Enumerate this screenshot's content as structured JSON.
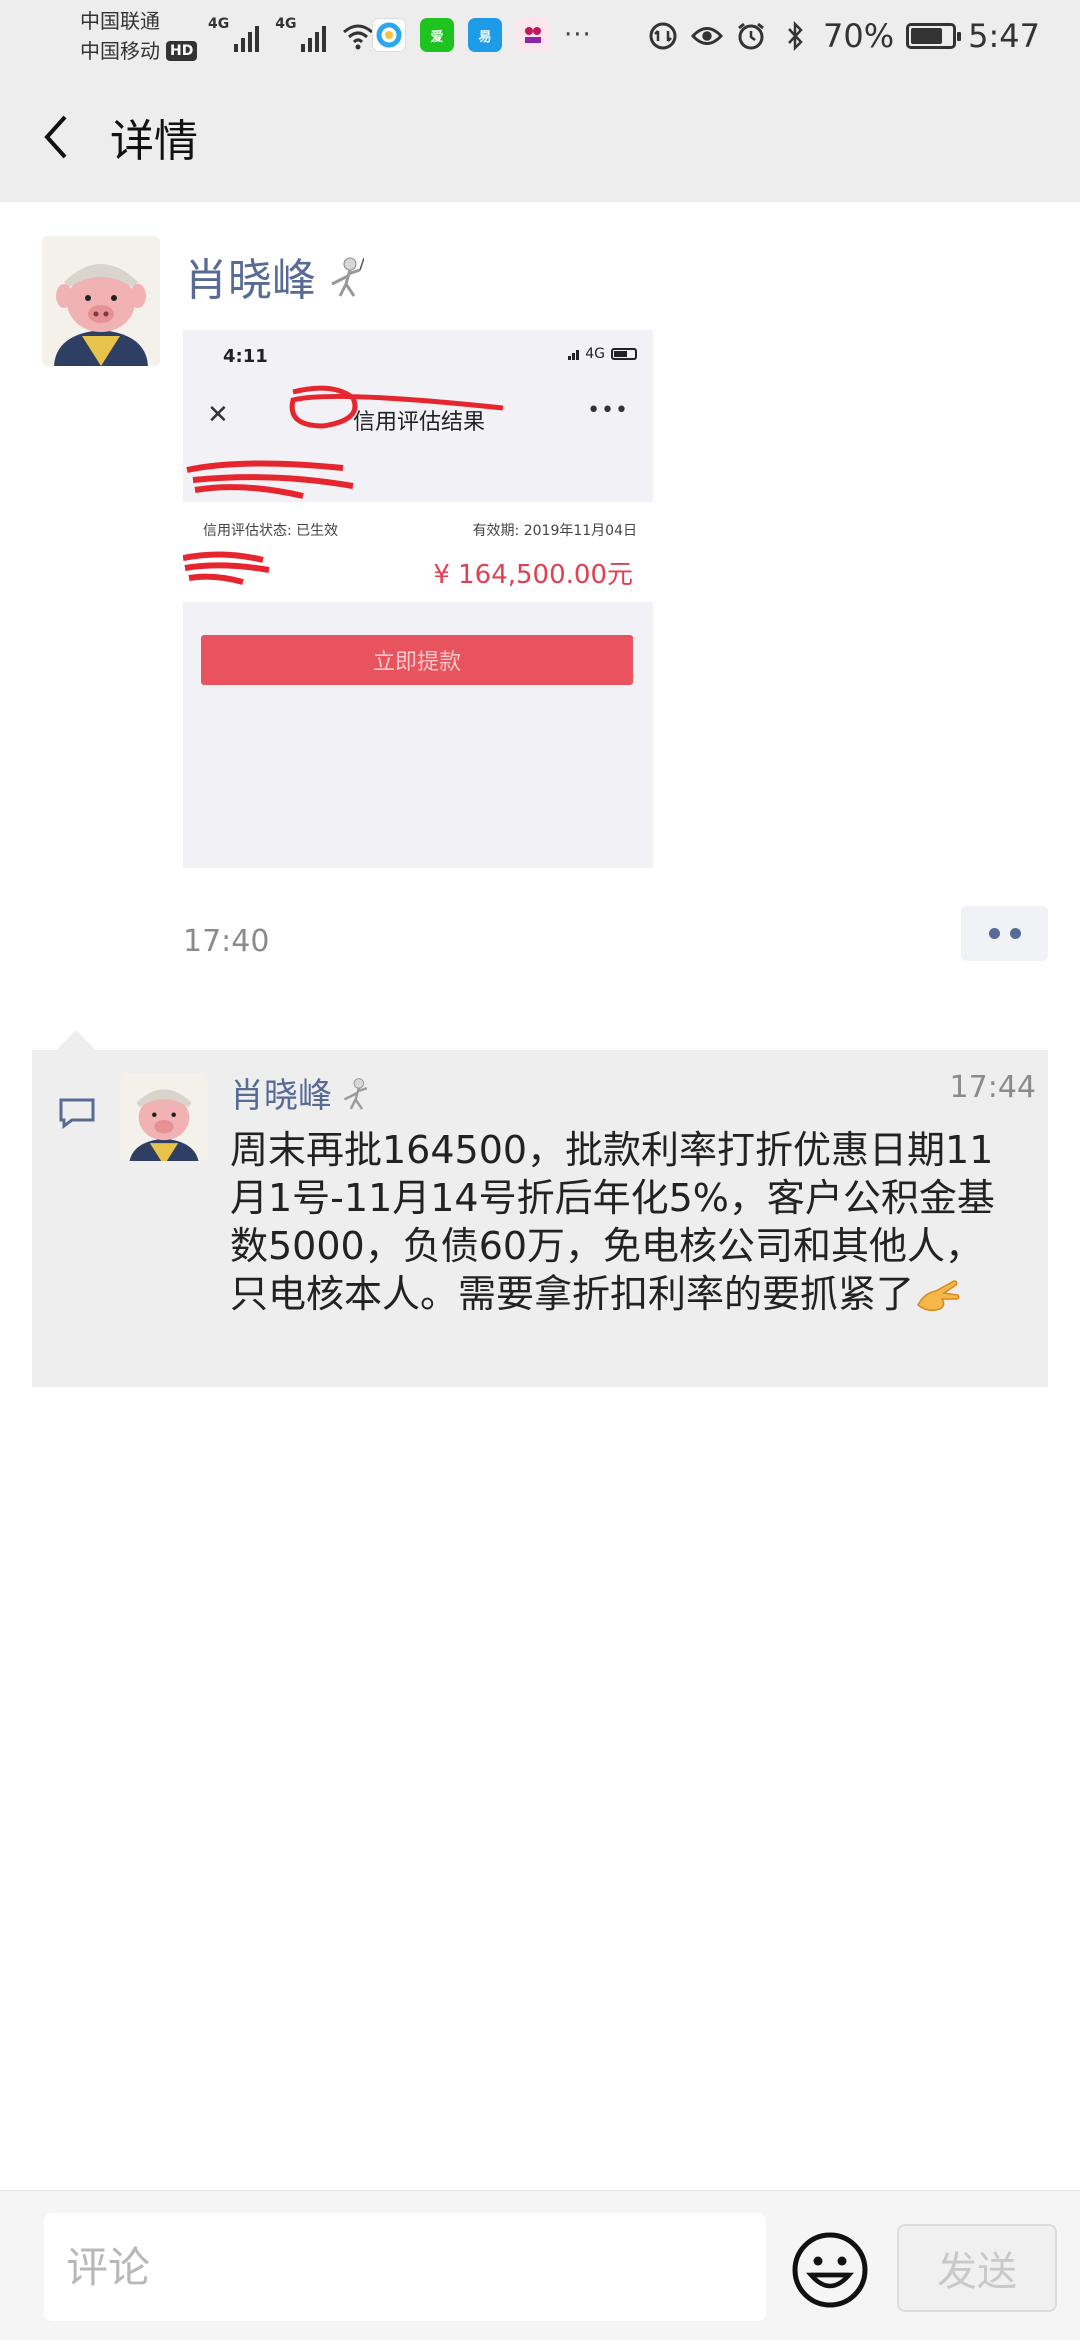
{
  "status_bar": {
    "carrier_1": "中国联通",
    "carrier_2": "中国移动",
    "hd_badge": "HD",
    "network_1": "4G",
    "network_2": "4G",
    "battery_percent": "70%",
    "battery_level": 0.7,
    "time": "5:47",
    "app_icons": [
      "qq-browser-icon",
      "iqiyi-icon",
      "netease-icon",
      "app-icon"
    ]
  },
  "nav": {
    "back_icon": "chevron-left-icon",
    "title": "详情"
  },
  "post": {
    "author": "肖晓峰",
    "author_emoji": "fencer-emoji",
    "time": "17:40",
    "more_icon": "two-dots-icon",
    "screenshot": {
      "time": "4:11",
      "network": "4G",
      "title": "信用评估结果",
      "status_label": "信用评估状态: 已生效",
      "valid_until": "有效期: 2019年11月04日",
      "amount": "¥ 164,500.00元",
      "button_label": "立即提款"
    }
  },
  "comments": [
    {
      "author": "肖晓峰",
      "time": "17:44",
      "text": "周末再批164500，批款利率打折优惠日期11月1号-11月14号折后年化5%，客户公积金基数5000，负债60万，免电核公司和其他人，只电核本人。需要拿折扣利率的要抓紧了",
      "trailing_emoji": "ok-hand-emoji"
    }
  ],
  "input_bar": {
    "placeholder": "评论",
    "emoji_icon": "smiley-icon",
    "send_label": "发送"
  },
  "colors": {
    "link_blue": "#576b95",
    "bar_gray": "#ededed",
    "comment_bg": "#eeeeee",
    "amount_red": "#e04050"
  }
}
